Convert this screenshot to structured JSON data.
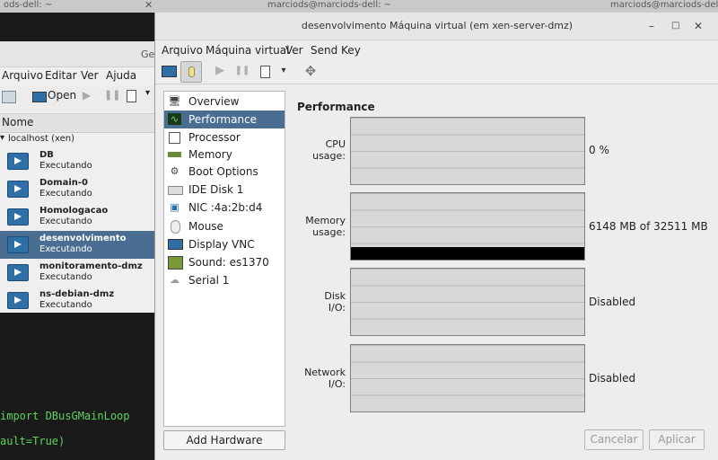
{
  "top_tabs": [
    {
      "label": "ods-dell: ~"
    },
    {
      "label": "marciods@marciods-dell: ~"
    },
    {
      "label": "marciods@marciods-dell: ~"
    }
  ],
  "terminal": {
    "lines": [
      "import DBusGMainLoop",
      "ault=True)"
    ]
  },
  "manager": {
    "title_partial": "Ge",
    "menu": [
      "Arquivo",
      "Editar",
      "Ver",
      "Ajuda"
    ],
    "toolbar_open": "Open",
    "column_header": "Nome",
    "host": "localhost (xen)",
    "vms": [
      {
        "name": "DB",
        "state": "Executando"
      },
      {
        "name": "Domain-0",
        "state": "Executando"
      },
      {
        "name": "Homologacao",
        "state": "Executando"
      },
      {
        "name": "desenvolvimento",
        "state": "Executando",
        "selected": true
      },
      {
        "name": "monitoramento-dmz",
        "state": "Executando"
      },
      {
        "name": "ns-debian-dmz",
        "state": "Executando"
      }
    ]
  },
  "dialog": {
    "title": "desenvolvimento Máquina virtual (em xen-server-dmz)",
    "window_buttons": [
      "–",
      "□",
      "✕"
    ],
    "menu": [
      "Arquivo",
      "Máquina virtual",
      "Ver",
      "Send Key"
    ],
    "hardware": [
      {
        "label": "Overview",
        "icon": "monitor-icon"
      },
      {
        "label": "Performance",
        "icon": "performance-icon",
        "selected": true
      },
      {
        "label": "Processor",
        "icon": "cpu-icon"
      },
      {
        "label": "Memory",
        "icon": "memory-icon"
      },
      {
        "label": "Boot Options",
        "icon": "gear-icon"
      },
      {
        "label": "IDE Disk 1",
        "icon": "disk-icon"
      },
      {
        "label": "NIC :4a:2b:d4",
        "icon": "network-icon"
      },
      {
        "label": "Mouse",
        "icon": "mouse-icon"
      },
      {
        "label": "Display VNC",
        "icon": "display-icon"
      },
      {
        "label": "Sound: es1370",
        "icon": "sound-icon"
      },
      {
        "label": "Serial 1",
        "icon": "serial-icon"
      }
    ],
    "add_hardware": "Add Hardware",
    "performance": {
      "title": "Performance",
      "cpu": {
        "label_line1": "CPU",
        "label_line2": "usage:",
        "value": "0 %"
      },
      "memory": {
        "label_line1": "Memory",
        "label_line2": "usage:",
        "value": "6148 MB of 32511 MB",
        "fill_fraction": 0.19
      },
      "disk": {
        "label_line1": "Disk",
        "label_line2": "I/O:",
        "value": "Disabled"
      },
      "network": {
        "label_line1": "Network",
        "label_line2": "I/O:",
        "value": "Disabled"
      }
    },
    "cancel_label": "Cancelar",
    "apply_label": "Aplicar"
  }
}
